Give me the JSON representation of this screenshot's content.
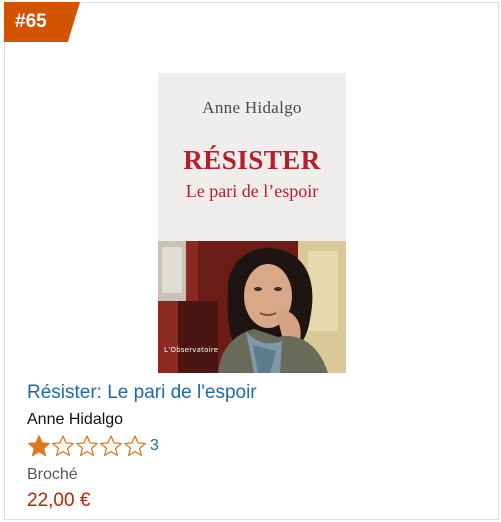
{
  "badge": {
    "rank": "#65",
    "color": "#d35400"
  },
  "cover": {
    "author": "Anne Hidalgo",
    "title": "RÉSISTER",
    "subtitle": "Le pari de l’espoir",
    "publisher": "L’Observatoire"
  },
  "product": {
    "title": "Résister: Le pari de l'espoir",
    "author": "Anne Hidalgo",
    "rating": {
      "value": 1,
      "max": 5,
      "count": "3",
      "star_color": "#de7921"
    },
    "format": "Broché",
    "price": "22,00 €"
  }
}
